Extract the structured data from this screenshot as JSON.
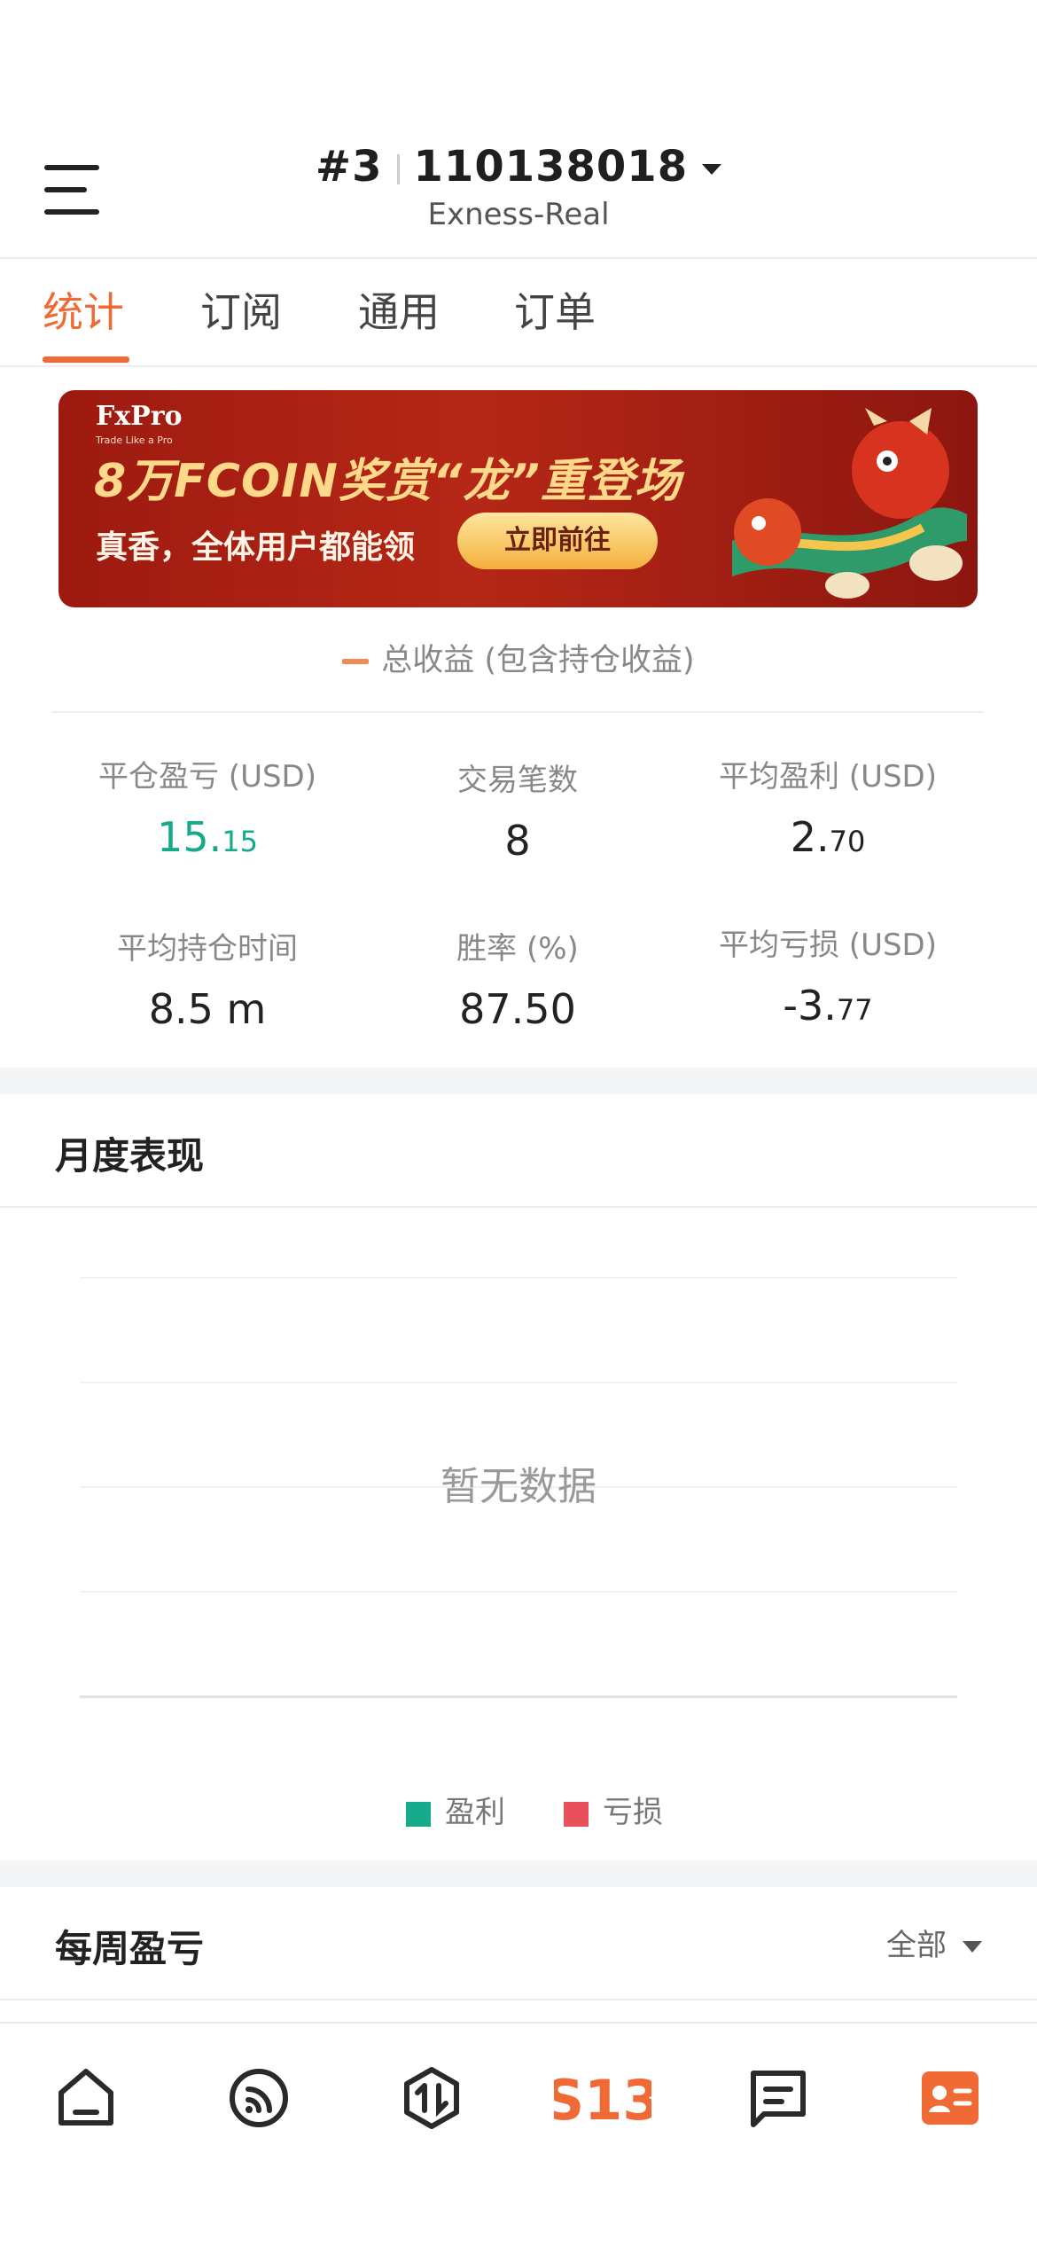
{
  "header": {
    "account_number": "#3",
    "account_id": "110138018",
    "server": "Exness-Real"
  },
  "tabs": [
    {
      "label": "统计",
      "active": true
    },
    {
      "label": "订阅",
      "active": false
    },
    {
      "label": "通用",
      "active": false
    },
    {
      "label": "订单",
      "active": false
    }
  ],
  "banner": {
    "brand": "FxPro",
    "brand_tagline": "Trade Like a Pro",
    "headline": "8万FCOIN奖赏“龙”重登场",
    "subline": "真香，全体用户都能领",
    "cta": "立即前往"
  },
  "legend": {
    "total_profit": "总收益 (包含持仓收益)"
  },
  "stats": {
    "closed_pnl_label": "平仓盈亏 (USD)",
    "closed_pnl_int": "15.",
    "closed_pnl_dec": "15",
    "trades_label": "交易笔数",
    "trades_value": "8",
    "avg_profit_label": "平均盈利 (USD)",
    "avg_profit_int": "2.",
    "avg_profit_dec": "70",
    "avg_hold_label": "平均持仓时间",
    "avg_hold_value": "8.5 m",
    "win_rate_label": "胜率 (%)",
    "win_rate_value": "87.50",
    "avg_loss_label": "平均亏损 (USD)",
    "avg_loss_int": "-3.",
    "avg_loss_dec": "77"
  },
  "monthly": {
    "title": "月度表现",
    "empty_text": "暂无数据",
    "legend_profit": "盈利",
    "legend_loss": "亏损"
  },
  "weekly": {
    "title": "每周盈亏",
    "filter": "全部"
  },
  "colors": {
    "accent": "#f06a35",
    "profit_green": "#16a98a",
    "loss_red": "#e8505b"
  },
  "nav": [
    "home-icon",
    "feed-icon",
    "trade-icon",
    "s13-logo-icon",
    "message-icon",
    "profile-card-icon"
  ]
}
